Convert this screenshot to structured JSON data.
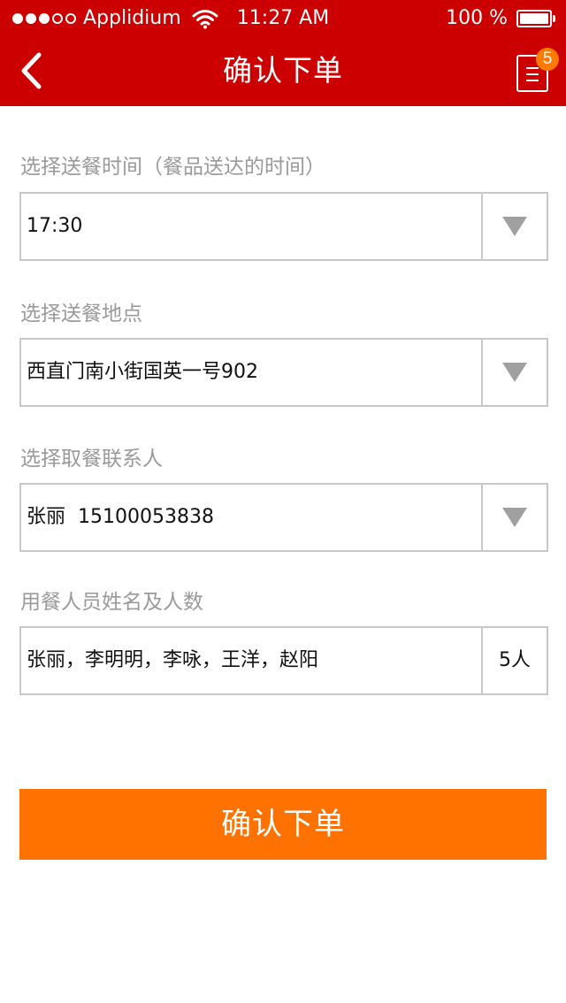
{
  "status_bar": {
    "carrier": "Applidium",
    "time": "11:27 AM",
    "battery": "100 %"
  },
  "nav": {
    "title": "确认下单",
    "order_badge_count": "5"
  },
  "form": {
    "delivery_time": {
      "label": "选择送餐时间（餐品送达的时间）",
      "value": "17:30"
    },
    "delivery_location": {
      "label": "选择送餐地点",
      "value": "西直门南小街国英一号902"
    },
    "pickup_contact": {
      "label": "选择取餐联系人",
      "value": "张丽  15100053838"
    },
    "diners": {
      "label": "用餐人员姓名及人数",
      "value": "张丽，李明明，李咏，王洋，赵阳",
      "count": "5人"
    }
  },
  "submit_label": "确认下单",
  "colors": {
    "header": "#cc0000",
    "accent": "#ff7200",
    "badge": "#ff7a00",
    "label": "#9a9a9a",
    "border": "#c8c8c8"
  }
}
